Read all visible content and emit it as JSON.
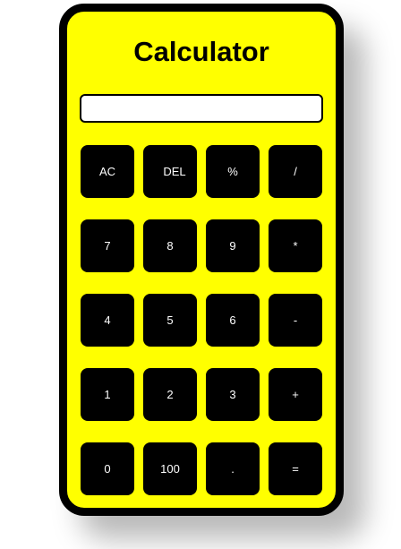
{
  "calculator": {
    "title": "Calculator",
    "display_value": "",
    "colors": {
      "body": "#ffff00",
      "frame": "#000000",
      "key_background": "#000000",
      "key_text": "#ffffff",
      "display_background": "#ffffff"
    },
    "keys": [
      {
        "label": "AC",
        "name": "all-clear-button"
      },
      {
        "label": "DEL",
        "name": "delete-button"
      },
      {
        "label": "%",
        "name": "percent-button"
      },
      {
        "label": "/",
        "name": "divide-button"
      },
      {
        "label": "7",
        "name": "digit-7-button"
      },
      {
        "label": "8",
        "name": "digit-8-button"
      },
      {
        "label": "9",
        "name": "digit-9-button"
      },
      {
        "label": "*",
        "name": "multiply-button"
      },
      {
        "label": "4",
        "name": "digit-4-button"
      },
      {
        "label": "5",
        "name": "digit-5-button"
      },
      {
        "label": "6",
        "name": "digit-6-button"
      },
      {
        "label": "-",
        "name": "subtract-button"
      },
      {
        "label": "1",
        "name": "digit-1-button"
      },
      {
        "label": "2",
        "name": "digit-2-button"
      },
      {
        "label": "3",
        "name": "digit-3-button"
      },
      {
        "label": "+",
        "name": "add-button"
      },
      {
        "label": "0",
        "name": "digit-0-button"
      },
      {
        "label": "100",
        "name": "hundred-button"
      },
      {
        "label": ".",
        "name": "decimal-point-button"
      },
      {
        "label": "=",
        "name": "equals-button"
      }
    ]
  }
}
